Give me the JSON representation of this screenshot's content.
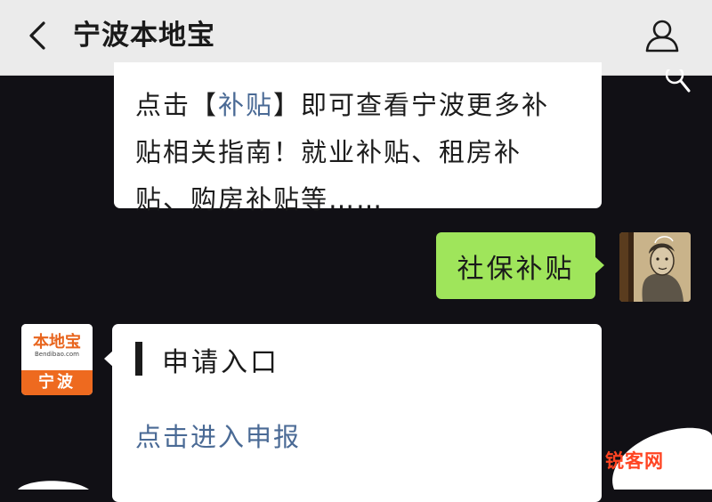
{
  "header": {
    "title": "宁波本地宝"
  },
  "messages": {
    "msg1": {
      "line1_before": "点击【",
      "line1_link": "补贴",
      "line1_after": "】即可查看宁波更多补",
      "line2": "贴相关指南！就业补贴、租房补",
      "line3": "贴、购房补贴等……"
    },
    "sent": {
      "text": "社保补贴"
    },
    "bot_avatar": {
      "logo_text": "本地宝",
      "logo_sub": "Bendibao.com",
      "city": "宁波"
    },
    "msg2": {
      "heading": "申请入口",
      "link": "点击进入申报"
    }
  },
  "watermark": {
    "text": "锐客网"
  },
  "colors": {
    "sent_bubble": "#9fe55b",
    "link": "#4a6a95",
    "brand_orange": "#ee6a1f",
    "background": "#111015"
  }
}
